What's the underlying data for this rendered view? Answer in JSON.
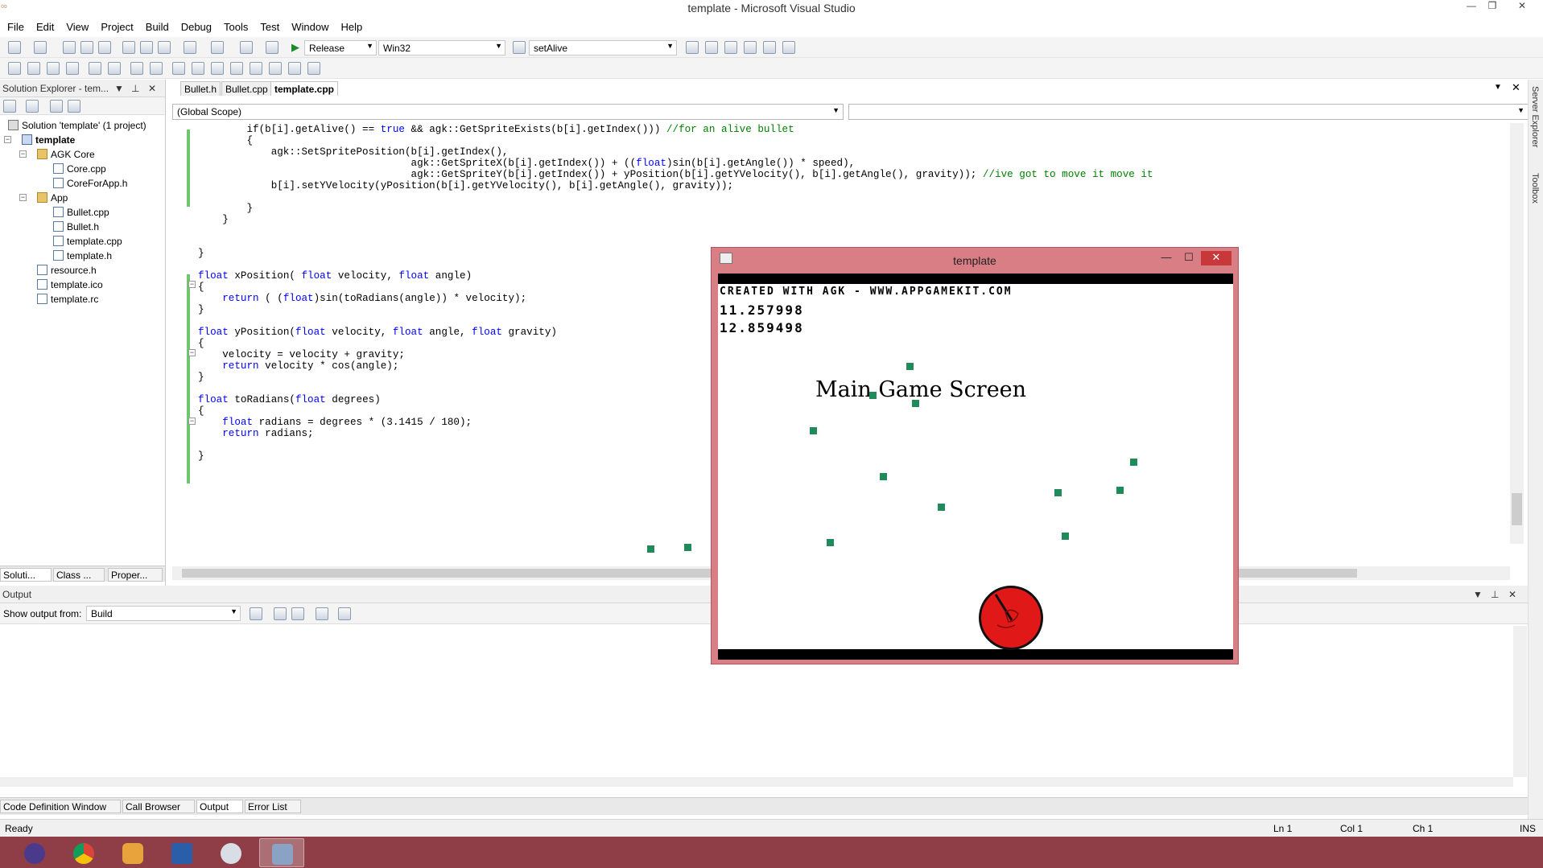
{
  "window": {
    "title": "template - Microsoft Visual Studio"
  },
  "menu": [
    "File",
    "Edit",
    "View",
    "Project",
    "Build",
    "Debug",
    "Tools",
    "Test",
    "Window",
    "Help"
  ],
  "toolbar": {
    "config": "Release",
    "platform": "Win32",
    "find": "setAlive"
  },
  "solution_explorer": {
    "title": "Solution Explorer - tem...",
    "items": [
      {
        "label": "Solution 'template' (1 project)",
        "icon": "solution-icon"
      },
      {
        "label": "template",
        "icon": "project-icon"
      },
      {
        "label": "AGK Core",
        "icon": "folder-icon"
      },
      {
        "label": "Core.cpp",
        "icon": "cpp-file-icon"
      },
      {
        "label": "CoreForApp.h",
        "icon": "header-file-icon"
      },
      {
        "label": "App",
        "icon": "folder-icon"
      },
      {
        "label": "Bullet.cpp",
        "icon": "cpp-file-icon"
      },
      {
        "label": "Bullet.h",
        "icon": "header-file-icon"
      },
      {
        "label": "template.cpp",
        "icon": "cpp-file-icon"
      },
      {
        "label": "template.h",
        "icon": "header-file-icon"
      },
      {
        "label": "resource.h",
        "icon": "header-file-icon"
      },
      {
        "label": "template.ico",
        "icon": "icon-file-icon"
      },
      {
        "label": "template.rc",
        "icon": "resource-file-icon"
      }
    ],
    "tabs": [
      "Soluti...",
      "Class ...",
      "Proper..."
    ]
  },
  "editor": {
    "tabs": [
      "Bullet.h",
      "Bullet.cpp",
      "template.cpp"
    ],
    "active_tab": "template.cpp",
    "scope": "(Global Scope)",
    "member": "",
    "lines": [
      "        if(b[i].getAlive() == true && agk::GetSpriteExists(b[i].getIndex())) //for an alive bullet",
      "        {",
      "            agk::SetSpritePosition(b[i].getIndex(),",
      "                                   agk::GetSpriteX(b[i].getIndex()) + ((float)sin(b[i].getAngle()) * speed),",
      "                                   agk::GetSpriteY(b[i].getIndex()) + yPosition(b[i].getYVelocity(), b[i].getAngle(), gravity)); //ive got to move it move it",
      "            b[i].setYVelocity(yPosition(b[i].getYVelocity(), b[i].getAngle(), gravity));",
      "",
      "        }",
      "    }",
      "",
      "",
      "}",
      "",
      "float xPosition( float velocity, float angle)",
      "{",
      "    return ( (float)sin(toRadians(angle)) * velocity);",
      "}",
      "",
      "float yPosition(float velocity, float angle, float gravity)",
      "{",
      "    velocity = velocity + gravity;",
      "    return velocity * cos(angle);",
      "}",
      "",
      "float toRadians(float degrees)",
      "{",
      "    float radians = degrees * (3.1415 / 180);",
      "    return radians;",
      "",
      "}"
    ]
  },
  "output": {
    "title": "Output",
    "show_from_label": "Show output from:",
    "show_from_value": "Build",
    "tabs": [
      "Code Definition Window",
      "Call Browser",
      "Output",
      "Error List"
    ],
    "active_tab": "Output"
  },
  "right_rail": [
    "Server Explorer",
    "Toolbox"
  ],
  "status": {
    "text": "Ready",
    "ln": "Ln 1",
    "col": "Col 1",
    "ch": "Ch 1",
    "mode": "INS"
  },
  "game": {
    "title": "template",
    "banner": "CREATED WITH AGK - WWW.APPGAMEKIT.COM",
    "value1": "11.257998",
    "value2": "12.859498",
    "heading": "Main Game Screen"
  },
  "taskbar": [
    "eclipse-icon",
    "chrome-icon",
    "app-icon",
    "powershell-icon",
    "paint-icon",
    "agk-icon"
  ],
  "colors": {
    "keyword": "#0000ff",
    "comment": "#008000",
    "taskbar": "#8f3e47",
    "bullet": "#1f8a5a",
    "ball": "#e01818"
  }
}
